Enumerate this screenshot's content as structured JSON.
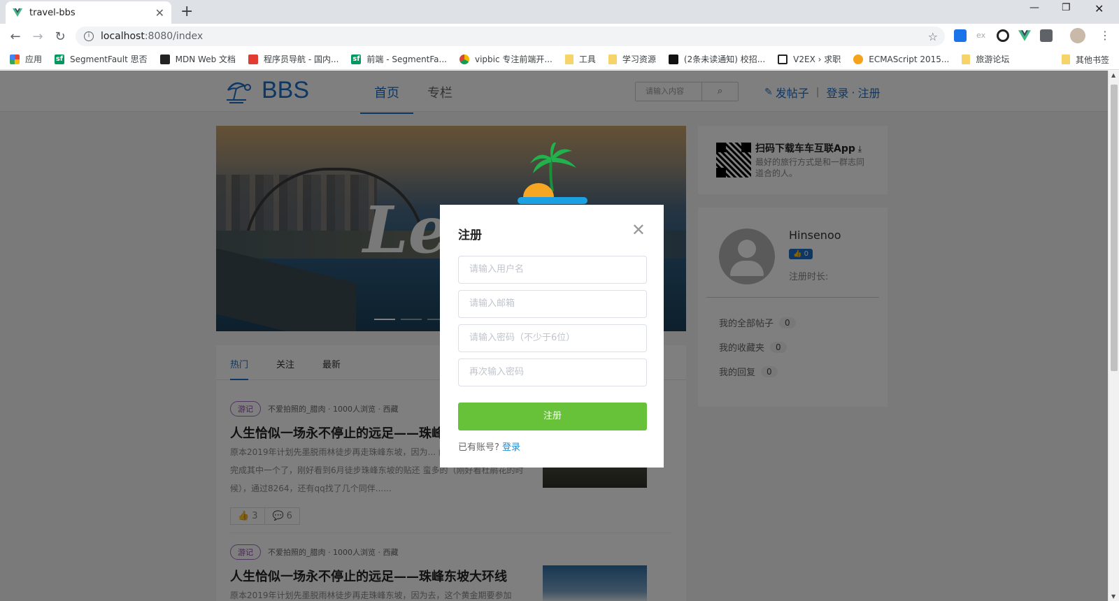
{
  "browser": {
    "tab_title": "travel-bbs",
    "url_host": "localhost",
    "url_rest": ":8080/index",
    "bookmarks": [
      {
        "label": "应用",
        "icon": "apps-grid-icon"
      },
      {
        "label": "SegmentFault 思否",
        "icon": "segmentfault-icon"
      },
      {
        "label": "MDN Web 文档",
        "icon": "mdn-icon"
      },
      {
        "label": "程序员导航 - 国内...",
        "icon": "coder-nav-icon"
      },
      {
        "label": "前端 - SegmentFa...",
        "icon": "segmentfault-icon"
      },
      {
        "label": "vipbic 专注前端开...",
        "icon": "vipbic-icon"
      },
      {
        "label": "工具",
        "icon": "folder-icon"
      },
      {
        "label": "学习资源",
        "icon": "folder-icon"
      },
      {
        "label": "(2条未读通知) 校招...",
        "icon": "nowcoder-icon"
      },
      {
        "label": "V2EX › 求职",
        "icon": "v2ex-icon"
      },
      {
        "label": "ECMAScript 2015...",
        "icon": "ecma-icon"
      },
      {
        "label": "旅游论坛",
        "icon": "folder-icon"
      }
    ],
    "other_bookmarks": "其他书签"
  },
  "site": {
    "logo_text": "BBS",
    "nav": [
      {
        "label": "首页",
        "active": true
      },
      {
        "label": "专栏",
        "active": false
      }
    ],
    "search_placeholder": "请输入内容",
    "post_label": "发帖子",
    "login_label": "登录",
    "dot": "·",
    "register_label": "注册"
  },
  "banner": {
    "script_text": "Let"
  },
  "feed": {
    "tabs": [
      {
        "label": "热门",
        "active": true
      },
      {
        "label": "关注",
        "active": false
      },
      {
        "label": "最新",
        "active": false
      }
    ],
    "articles": [
      {
        "tag": "游记",
        "meta": "不爱拍照的_腊肉 · 1000人浏览 · 西藏",
        "title": "人生恰似一场永不停止的远足——珠峰",
        "desc": "原本2019年计划先墨脱雨林徒步再走珠峰东坡，因为... 闺蜜的婚礼，所以就只能完成其中一个了，刚好看到6月徒步珠峰东坡的贴还 蛮多的（刚好看杜鹃花的时候），通过8264，还有qq找了几个同伴......",
        "likes": "3",
        "comments": "6"
      },
      {
        "tag": "游记",
        "meta": "不爱拍照的_腊肉 · 1000人浏览 · 西藏",
        "title": "人生恰似一场永不停止的远足——珠峰东坡大环线",
        "desc": "原本2019年计划先墨脱雨林徒步再走珠峰东坡，因为去，这个黄金期要参加"
      }
    ]
  },
  "sidebar": {
    "app_title": "扫码下载车车互联App",
    "app_sub": "最好的旅行方式是和一群志同道合的人。",
    "username": "Hinsenoo",
    "likes": "0",
    "reg_time_label": "注册时长:",
    "stats": [
      {
        "label": "我的全部帖子",
        "count": "0"
      },
      {
        "label": "我的收藏夹",
        "count": "0"
      },
      {
        "label": "我的回复",
        "count": "0"
      }
    ]
  },
  "modal": {
    "title": "注册",
    "username_placeholder": "请输入用户名",
    "email_placeholder": "请输入邮箱",
    "password_placeholder": "请输入密码（不少于6位）",
    "confirm_placeholder": "再次输入密码",
    "submit_label": "注册",
    "have_account": "已有账号?",
    "login_link": "登录"
  },
  "colors": {
    "primary": "#1f6fc6",
    "success": "#67c23a",
    "tag_purple": "#8e44ad"
  }
}
